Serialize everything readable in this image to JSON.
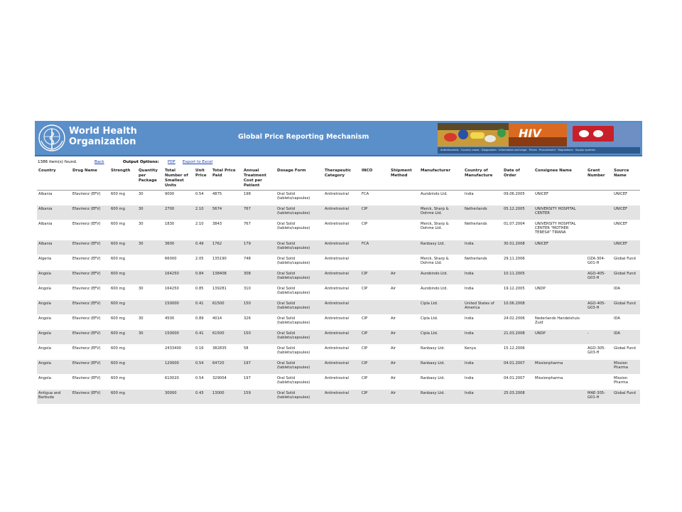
{
  "header": {
    "org_line1": "World Health",
    "org_line2": "Organization",
    "title": "Global Price Reporting Mechanism",
    "nav_strip": "Antiretrovirals · Country cases · Diagnostics · Information exchange · Prices · Procurement · Regulations · Supply systems",
    "colors": {
      "banner": "#5b8fc9",
      "banner_border": "#3f6fa8",
      "link": "#1a3fb0",
      "alt_row": "#e3e3e3"
    },
    "icons": [
      "who-emblem-icon",
      "medicine-photo",
      "hiv-photo",
      "pills-photo"
    ]
  },
  "toolbar": {
    "count_text": "1386 item(s) found.",
    "back_label": "Back",
    "output_label": "Output Options:",
    "pdf_label": "PDF",
    "excel_label": "Export to Excel"
  },
  "table": {
    "headers": [
      "Country",
      "Drug Name",
      "Strength",
      "Quantity per Package",
      "Total Number of Smallest Units",
      "Unit Price",
      "Total Price Paid",
      "Annual Treatment Cost per Patient",
      "Dosage Form",
      "Therapeutic Category",
      "INCO",
      "Shipment Method",
      "Manufacturer",
      "Country of Manufacture",
      "Date of Order",
      "Consignee Name",
      "Grant Number",
      "Source Name"
    ],
    "rows": [
      [
        "Albania",
        "Efavirenz (EFV)",
        "600 mg",
        "30",
        "9000",
        "0.54",
        "4875",
        "198",
        "Oral Solid (tablets/capsules)",
        "Antiretroviral",
        "FCA",
        "",
        "Aurobindo Ltd.",
        "India",
        "09.06.2005",
        "UNICEF",
        "",
        "UNICEF"
      ],
      [
        "Albania",
        "Efavirenz (EFV)",
        "600 mg",
        "30",
        "2700",
        "2.10",
        "5674",
        "767",
        "Oral Solid (tablets/capsules)",
        "Antiretroviral",
        "CIP",
        "",
        "Merck, Sharp & Dohme Ltd.",
        "Netherlands",
        "05.12.2005",
        "UNIVERSITY HOSPITAL CENTER",
        "",
        "UNICEF"
      ],
      [
        "Albania",
        "Efavirenz (EFV)",
        "600 mg",
        "30",
        "1830",
        "2.10",
        "3843",
        "767",
        "Oral Solid (tablets/capsules)",
        "Antiretroviral",
        "CIP",
        "",
        "Merck, Sharp & Dohme Ltd.",
        "Netherlands",
        "01.07.2004",
        "UNIVERSITY HOSPITAL CENTER \"MOTHER TERESA\" TIRANA",
        "",
        "UNICEF"
      ],
      [
        "Albania",
        "Efavirenz (EFV)",
        "600 mg",
        "30",
        "3600",
        "0.49",
        "1762",
        "179",
        "Oral Solid (tablets/capsules)",
        "Antiretroviral",
        "FCA",
        "",
        "Ranbaxy Ltd.",
        "India",
        "30.01.2008",
        "UNICEF",
        "",
        "UNICEF"
      ],
      [
        "Algeria",
        "Efavirenz (EFV)",
        "600 mg",
        "",
        "66000",
        "2.05",
        "135190",
        "748",
        "Oral Solid (tablets/capsules)",
        "Antiretroviral",
        "",
        "",
        "Merck, Sharp & Dohme Ltd.",
        "Netherlands",
        "29.11.2006",
        "",
        "DZA-304-G01-H",
        "Global Fund"
      ],
      [
        "Angola",
        "Efavirenz (EFV)",
        "600 mg",
        "",
        "164250",
        "0.84",
        "138408",
        "308",
        "Oral Solid (tablets/capsules)",
        "Antiretroviral",
        "CIP",
        "Air",
        "Aurobindo Ltd.",
        "India",
        "10.11.2005",
        "",
        "AGO-405-G03-H",
        "Global Fund"
      ],
      [
        "Angola",
        "Efavirenz (EFV)",
        "600 mg",
        "30",
        "164250",
        "0.85",
        "139281",
        "310",
        "Oral Solid (tablets/capsules)",
        "Antiretroviral",
        "CIP",
        "Air",
        "Aurobindo Ltd.",
        "India",
        "19.12.2005",
        "UNDP",
        "",
        "IDA"
      ],
      [
        "Angola",
        "Efavirenz (EFV)",
        "600 mg",
        "",
        "150000",
        "0.41",
        "61500",
        "150",
        "Oral Solid (tablets/capsules)",
        "Antiretroviral",
        "",
        "",
        "Cipla Ltd.",
        "United States of America",
        "10.06.2008",
        "",
        "AGO-405-G03-H",
        "Global Fund"
      ],
      [
        "Angola",
        "Efavirenz (EFV)",
        "600 mg",
        "30",
        "4500",
        "0.89",
        "4014",
        "326",
        "Oral Solid (tablets/capsules)",
        "Antiretroviral",
        "CIP",
        "Air",
        "Cipla Ltd.",
        "India",
        "24.02.2006",
        "Nederlands Handelshuis Zuid",
        "",
        "IDA"
      ],
      [
        "Angola",
        "Efavirenz (EFV)",
        "600 mg",
        "30",
        "150000",
        "0.41",
        "61500",
        "150",
        "Oral Solid (tablets/capsules)",
        "Antiretroviral",
        "CIP",
        "Air",
        "Cipla Ltd.",
        "India",
        "21.03.2008",
        "UNDP",
        "-",
        "IDA"
      ],
      [
        "Angola",
        "Efavirenz (EFV)",
        "600 mg",
        "",
        "2433400",
        "0.16",
        "382835",
        "58",
        "Oral Solid (tablets/capsules)",
        "Antiretroviral",
        "CIP",
        "Air",
        "Ranbaxy Ltd.",
        "Kenya",
        "15.12.2006",
        "",
        "AGO-305-G03-H",
        "Global Fund"
      ],
      [
        "Angola",
        "Efavirenz (EFV)",
        "600 mg",
        "",
        "120000",
        "0.54",
        "64720",
        "197",
        "Oral Solid (tablets/capsules)",
        "Antiretroviral",
        "CIP",
        "Air",
        "Ranbaxy Ltd.",
        "India",
        "04.01.2007",
        "Missionpharma",
        "",
        "Mission Pharma"
      ],
      [
        "Angola",
        "Efavirenz (EFV)",
        "600 mg",
        "",
        "610020",
        "0.54",
        "329004",
        "197",
        "Oral Solid (tablets/capsules)",
        "Antiretroviral",
        "CIP",
        "Air",
        "Ranbaxy Ltd.",
        "India",
        "04.01.2007",
        "Missionpharma",
        "",
        "Mission Pharma"
      ],
      [
        "Antigua and Barbuda",
        "Efavirenz (EFV)",
        "600 mg",
        "",
        "30000",
        "0.43",
        "13000",
        "159",
        "Oral Solid (tablets/capsules)",
        "Antiretroviral",
        "CIP",
        "Air",
        "Ranbaxy Ltd.",
        "India",
        "25.03.2008",
        "",
        "MAE-305-G01-H",
        "Global Fund"
      ]
    ]
  }
}
